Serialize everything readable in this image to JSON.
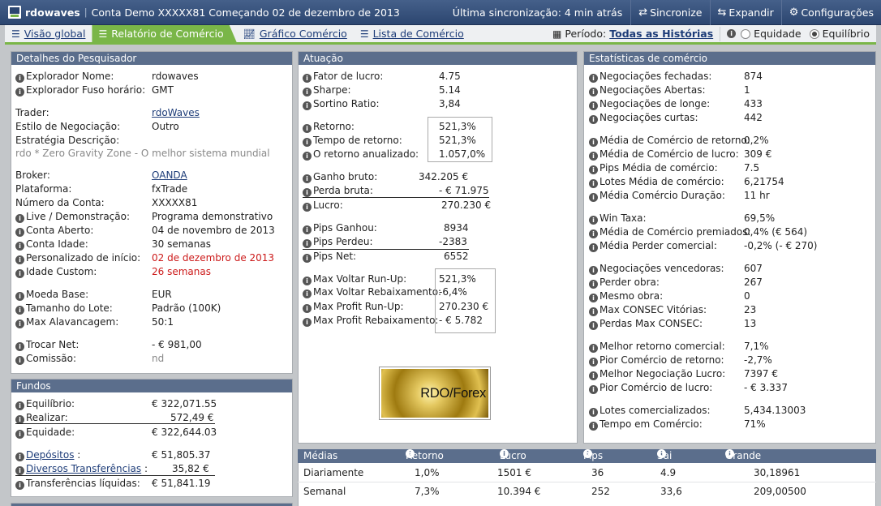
{
  "topbar": {
    "brand": "rdowaves",
    "account": "Conta Demo XXXXX81 Começando 02 de dezembro de 2013",
    "sync": "Última sincronização: 4 min atrás",
    "buttons": [
      "Sincronize",
      "Expandir",
      "Configurações"
    ]
  },
  "nav": {
    "items": [
      "Visão global",
      "Relatório de Comércio",
      "Gráfico Comércio",
      "Lista de Comércio"
    ],
    "period_label": "Período:",
    "period_value": "Todas as Histórias",
    "radio": [
      "Equidade",
      "Equilíbrio"
    ],
    "selected_radio": "Equilíbrio"
  },
  "researcher": {
    "title": "Detalhes do Pesquisador",
    "rows": [
      {
        "label": "Explorador Nome:",
        "value": "rdowaves",
        "info": true
      },
      {
        "label": "Explorador Fuso horário:",
        "value": "GMT",
        "info": true
      },
      {
        "label": "Trader:",
        "value": "rdoWaves",
        "info": false
      },
      {
        "label": "Estilo de Negociação:",
        "value": "Outro",
        "info": false
      },
      {
        "label": "Estratégia Descrição:",
        "value": "",
        "info": false
      },
      {
        "label": "",
        "value": "rdo * Zero Gravity Zone - O melhor sistema mundial",
        "info": false
      },
      {
        "label": "Broker:",
        "value": "OANDA",
        "info": false
      },
      {
        "label": "Plataforma:",
        "value": "fxTrade",
        "info": false
      },
      {
        "label": "Número da Conta:",
        "value": "XXXXX81",
        "info": false
      },
      {
        "label": "Live / Demonstração:",
        "value": "Programa demonstrativo",
        "info": true
      },
      {
        "label": "Conta Aberto:",
        "value": "04 de novembro de 2013",
        "info": true
      },
      {
        "label": "Conta Idade:",
        "value": "30 semanas",
        "info": true
      },
      {
        "label": "Personalizado de início:",
        "value": "02 de dezembro de 2013",
        "info": true
      },
      {
        "label": "Idade Custom:",
        "value": "26 semanas",
        "info": true
      },
      {
        "label": "Moeda Base:",
        "value": "EUR",
        "info": true
      },
      {
        "label": "Tamanho do Lote:",
        "value": "Padrão (100K)",
        "info": true
      },
      {
        "label": "Max Alavancagem:",
        "value": "50:1",
        "info": true
      },
      {
        "label": "Trocar Net:",
        "value": "- € 981,00",
        "info": true
      },
      {
        "label": "Comissão:",
        "value": "nd",
        "info": true
      }
    ]
  },
  "funds": {
    "title": "Fundos",
    "rows": [
      {
        "label": "Equilíbrio:",
        "value": "€ 322,071.55"
      },
      {
        "label": "Realizar:",
        "value": "572,49 €"
      },
      {
        "label": "Equidade:",
        "value": "€ 322,644.03"
      },
      {
        "label": "Depósitos",
        "value": "€ 51,805.37"
      },
      {
        "label": "Diversos Transferências",
        "value": "35,82 €"
      },
      {
        "label": "Transferências líquidas:",
        "value": "€ 51,841.19"
      }
    ]
  },
  "performance": {
    "title": "Atuação",
    "rows": [
      {
        "label": "Fator de lucro:",
        "value": "4.75"
      },
      {
        "label": "Sharpe:",
        "value": "5.14"
      },
      {
        "label": "Sortino Ratio:",
        "value": "3,84"
      },
      {
        "label": "Retorno:",
        "value": "521,3%"
      },
      {
        "label": "Tempo de retorno:",
        "value": "521,3%"
      },
      {
        "label": "O retorno anualizado:",
        "value": "1.057,0%"
      },
      {
        "label": "Ganho bruto:",
        "value": "342.205 €"
      },
      {
        "label": "Perda bruta:",
        "value": "- € 71.975"
      },
      {
        "label": "Lucro:",
        "value": "270.230 €"
      },
      {
        "label": "Pips Ganhou:",
        "value": "8934"
      },
      {
        "label": "Pips Perdeu:",
        "value": "-2383"
      },
      {
        "label": "Pips Net:",
        "value": "6552"
      },
      {
        "label": "Max Voltar Run-Up:",
        "value": "521,3%"
      },
      {
        "label": "Max Voltar Rebaixamento:",
        "value": "-6,4%"
      },
      {
        "label": "Max Profit Run-Up:",
        "value": "270.230 €"
      },
      {
        "label": "Max Profit Rebaixamento:",
        "value": "- € 5.782"
      }
    ],
    "logo_text": "RDO/Forex"
  },
  "stats": {
    "title": "Estatísticas de comércio",
    "rows": [
      {
        "label": "Negociações fechadas:",
        "value": "874"
      },
      {
        "label": "Negociações Abertas:",
        "value": "1"
      },
      {
        "label": "Negociações de longe:",
        "value": "433"
      },
      {
        "label": "Negociações curtas:",
        "value": "442"
      },
      {
        "label": "Média de Comércio de retorno:",
        "value": "0,2%"
      },
      {
        "label": "Média de Comércio de lucro:",
        "value": "309 €"
      },
      {
        "label": "Pips Média de comércio:",
        "value": "7.5"
      },
      {
        "label": "Lotes Média de comércio:",
        "value": "6,21754"
      },
      {
        "label": "Média Comércio Duração:",
        "value": "11 hr"
      },
      {
        "label": "Win Taxa:",
        "value": "69,5%"
      },
      {
        "label": "Média de Comércio premiados:",
        "value": "0,4% (€ 564)"
      },
      {
        "label": "Média Perder comercial:",
        "value": "-0,2% (- € 270)"
      },
      {
        "label": "Negociações vencedoras:",
        "value": "607"
      },
      {
        "label": "Perder obra:",
        "value": "267"
      },
      {
        "label": "Mesmo obra:",
        "value": "0"
      },
      {
        "label": "Max CONSEC Vitórias:",
        "value": "23"
      },
      {
        "label": "Perdas Max CONSEC:",
        "value": "13"
      },
      {
        "label": "Melhor retorno comercial:",
        "value": "7,1%"
      },
      {
        "label": "Pior Comércio de retorno:",
        "value": "-2,7%"
      },
      {
        "label": "Melhor Negociação Lucro:",
        "value": "7397 €"
      },
      {
        "label": "Pior Comércio de lucro:",
        "value": "- € 3.337"
      },
      {
        "label": "Lotes comercializados:",
        "value": "5,434.13003"
      },
      {
        "label": "Tempo em Comércio:",
        "value": "71%"
      }
    ]
  },
  "averages": {
    "headers": [
      "Médias",
      "Retorno",
      "Lucro",
      "Pips",
      "Sai",
      "Grande quantidade"
    ],
    "rows": [
      [
        "Diariamente",
        "1,0%",
        "1501 €",
        "36",
        "4.9",
        "30,18961"
      ],
      [
        "Semanal",
        "7,3%",
        "10.394 €",
        "252",
        "33,6",
        "209,00500"
      ]
    ]
  }
}
